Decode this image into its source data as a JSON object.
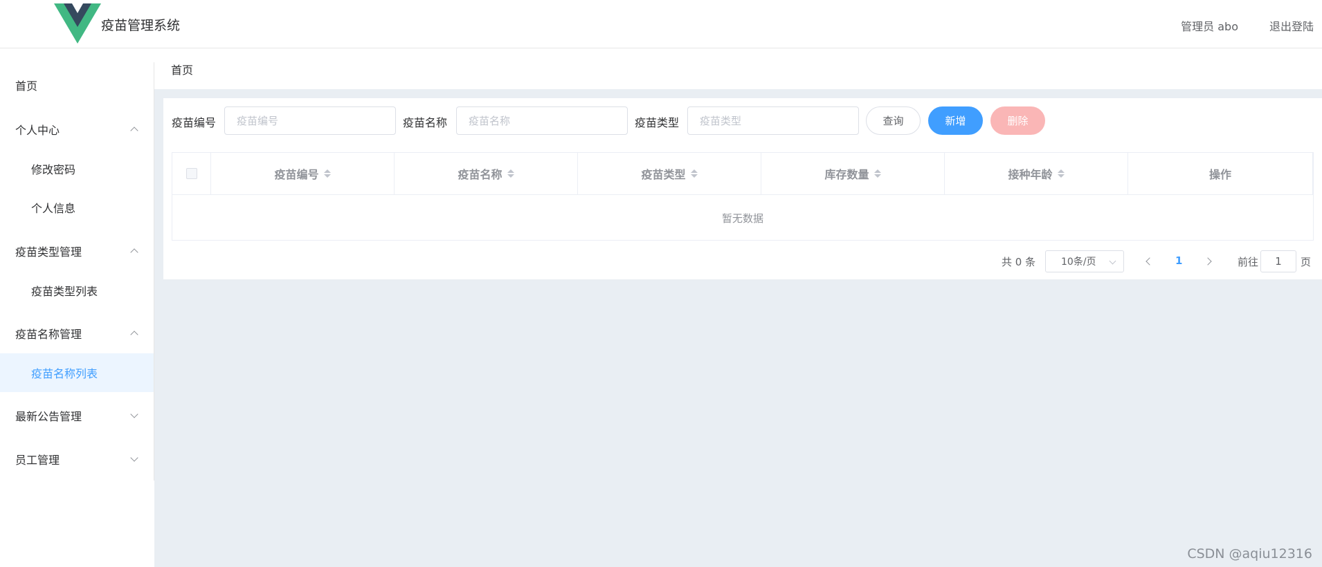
{
  "header": {
    "title": "疫苗管理系统",
    "admin_label": "管理员 abo",
    "logout_label": "退出登陆",
    "logo_colors": {
      "outer": "#41b883",
      "inner": "#35495e"
    }
  },
  "sidebar": {
    "items": [
      {
        "label": "首页"
      },
      {
        "label": "个人中心",
        "expanded": true
      },
      {
        "label": "修改密码"
      },
      {
        "label": "个人信息"
      },
      {
        "label": "疫苗类型管理",
        "expanded": true
      },
      {
        "label": "疫苗类型列表"
      },
      {
        "label": "疫苗名称管理",
        "expanded": true
      },
      {
        "label": "疫苗名称列表",
        "active": true
      },
      {
        "label": "最新公告管理",
        "expanded": false
      },
      {
        "label": "员工管理",
        "expanded": false
      }
    ]
  },
  "breadcrumb": {
    "current": "首页"
  },
  "search": {
    "code_label": "疫苗编号",
    "code_placeholder": "疫苗编号",
    "name_label": "疫苗名称",
    "name_placeholder": "疫苗名称",
    "type_label": "疫苗类型",
    "type_placeholder": "疫苗类型",
    "query_button": "查询",
    "add_button": "新增",
    "delete_button": "删除"
  },
  "table": {
    "columns": [
      "疫苗编号",
      "疫苗名称",
      "疫苗类型",
      "库存数量",
      "接种年龄",
      "操作"
    ],
    "empty_text": "暂无数据"
  },
  "pagination": {
    "total": "共 0 条",
    "page_size": "10条/页",
    "current_page": "1",
    "goto_prefix": "前往",
    "goto_value": "1",
    "goto_suffix": "页"
  },
  "watermark": "CSDN @aqiu12316",
  "colors": {
    "primary": "#409eff",
    "danger_disabled": "#fab6b6",
    "main_background": "#e9eef3",
    "active_menu_bg": "#ecf5ff"
  }
}
